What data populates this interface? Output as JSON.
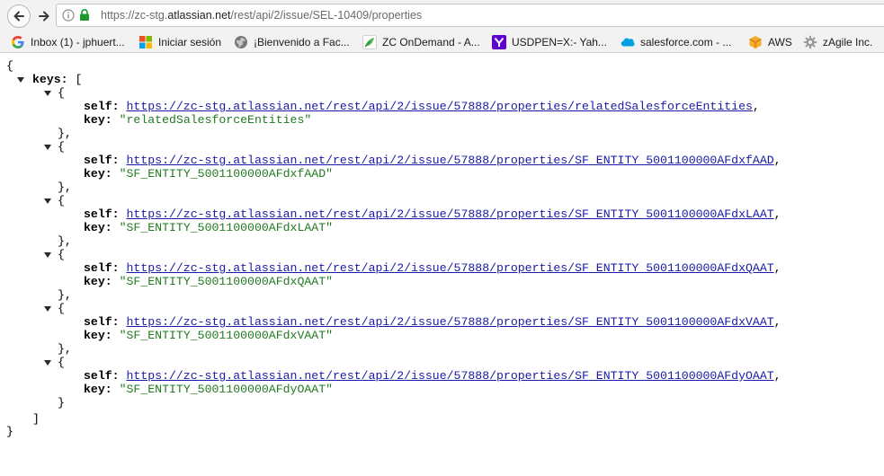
{
  "browser": {
    "url_prefix": "https://zc-stg.",
    "url_host": "atlassian.net",
    "url_path": "/rest/api/2/issue/SEL-10409/properties",
    "icons": {
      "back": "arrow-left-icon",
      "forward": "arrow-right-icon",
      "info": "info-circle-icon",
      "secure": "green-lock-icon"
    }
  },
  "bookmarks": [
    {
      "label": "Inbox (1) - jphuert...",
      "icon": "google-g-icon"
    },
    {
      "label": "Iniciar sesión",
      "icon": "microsoft-squares-icon"
    },
    {
      "label": "¡Bienvenido a Fac...",
      "icon": "globe-icon"
    },
    {
      "label": "ZC OnDemand - A...",
      "icon": "zc-leaf-icon"
    },
    {
      "label": "USDPEN=X:- Yah...",
      "icon": "yahoo-y-icon"
    },
    {
      "label": "salesforce.com - ...",
      "icon": "salesforce-cloud-icon"
    },
    {
      "label": "AWS",
      "icon": "aws-cube-icon"
    },
    {
      "label": "zAgile Inc.",
      "icon": "gear-icon"
    }
  ],
  "json": {
    "root_key": "keys",
    "self_label": "self",
    "key_label": "key",
    "entries": [
      {
        "self": "https://zc-stg.atlassian.net/rest/api/2/issue/57888/properties/relatedSalesforceEntities",
        "key": "relatedSalesforceEntities"
      },
      {
        "self": "https://zc-stg.atlassian.net/rest/api/2/issue/57888/properties/SF_ENTITY_5001100000AFdxfAAD",
        "key": "SF_ENTITY_5001100000AFdxfAAD"
      },
      {
        "self": "https://zc-stg.atlassian.net/rest/api/2/issue/57888/properties/SF_ENTITY_5001100000AFdxLAAT",
        "key": "SF_ENTITY_5001100000AFdxLAAT"
      },
      {
        "self": "https://zc-stg.atlassian.net/rest/api/2/issue/57888/properties/SF_ENTITY_5001100000AFdxQAAT",
        "key": "SF_ENTITY_5001100000AFdxQAAT"
      },
      {
        "self": "https://zc-stg.atlassian.net/rest/api/2/issue/57888/properties/SF_ENTITY_5001100000AFdxVAAT",
        "key": "SF_ENTITY_5001100000AFdxVAAT"
      },
      {
        "self": "https://zc-stg.atlassian.net/rest/api/2/issue/57888/properties/SF_ENTITY_5001100000AFdyOAAT",
        "key": "SF_ENTITY_5001100000AFdyOAAT"
      }
    ]
  }
}
